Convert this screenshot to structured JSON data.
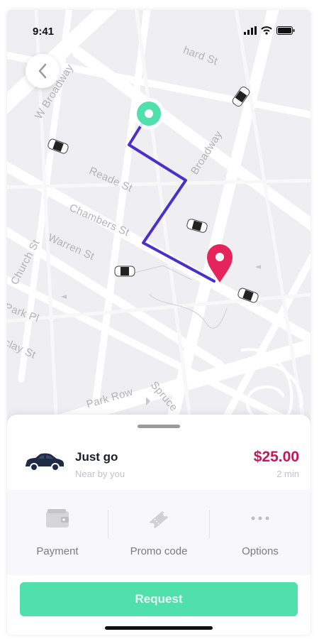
{
  "status_bar": {
    "time": "9:41"
  },
  "map": {
    "streets": [
      "W Broadway",
      "Reade St",
      "Chambers St",
      "Warren St",
      "Church St",
      "Park Pl",
      "clay St",
      "Park Row",
      "Spruce",
      "Broadway",
      "hard St"
    ],
    "route_color": "#4b2fc9",
    "origin_color": "#4fe0ac",
    "destination_color": "#e4245a"
  },
  "ride": {
    "name": "Just go",
    "subtitle": "Near by you",
    "price": "$25.00",
    "eta": "2 min"
  },
  "options": [
    {
      "label": "Payment",
      "icon": "wallet-icon"
    },
    {
      "label": "Promo code",
      "icon": "ticket-icon"
    },
    {
      "label": "Options",
      "icon": "more-icon"
    }
  ],
  "request_label": "Request",
  "colors": {
    "accent": "#4fe0ac",
    "price": "#c2185b",
    "route": "#4b2fc9",
    "pin": "#e4245a"
  }
}
